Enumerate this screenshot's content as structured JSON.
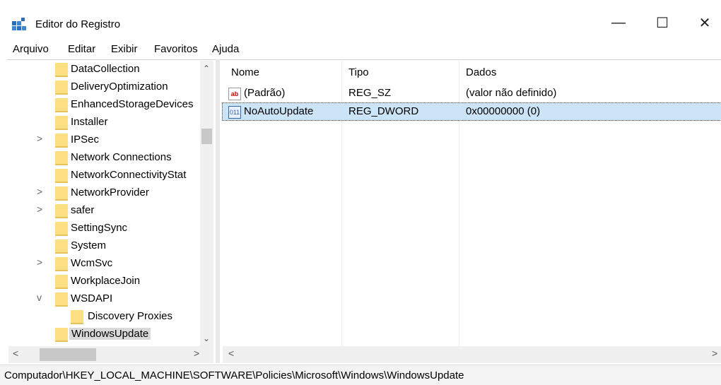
{
  "window": {
    "title": "Editor do Registro",
    "min": "—",
    "max": "☐",
    "close": "✕"
  },
  "menu": [
    "Arquivo",
    "Editar",
    "Exibir",
    "Favoritos",
    "Ajuda"
  ],
  "tree": {
    "items": [
      {
        "label": "DataCollection",
        "expander": ""
      },
      {
        "label": "DeliveryOptimization",
        "expander": ""
      },
      {
        "label": "EnhancedStorageDevices",
        "expander": ""
      },
      {
        "label": "Installer",
        "expander": ""
      },
      {
        "label": "IPSec",
        "expander": ">"
      },
      {
        "label": "Network Connections",
        "expander": ""
      },
      {
        "label": "NetworkConnectivityStat",
        "expander": ""
      },
      {
        "label": "NetworkProvider",
        "expander": ">"
      },
      {
        "label": "safer",
        "expander": ">"
      },
      {
        "label": "SettingSync",
        "expander": ""
      },
      {
        "label": "System",
        "expander": ""
      },
      {
        "label": "WcmSvc",
        "expander": ">"
      },
      {
        "label": "WorkplaceJoin",
        "expander": ""
      },
      {
        "label": "WSDAPI",
        "expander": "v"
      },
      {
        "label": "Discovery Proxies",
        "expander": ""
      },
      {
        "label": "WindowsUpdate",
        "expander": ""
      }
    ]
  },
  "list": {
    "columns": [
      "Nome",
      "Tipo",
      "Dados"
    ],
    "rows": [
      {
        "icon": "string-value-icon",
        "name": "(Padrão)",
        "type": "REG_SZ",
        "data": "(valor não definido)"
      },
      {
        "icon": "dword-value-icon",
        "name": "NoAutoUpdate",
        "type": "REG_DWORD",
        "data": "0x00000000 (0)"
      }
    ]
  },
  "status": {
    "path": "Computador\\HKEY_LOCAL_MACHINE\\SOFTWARE\\Policies\\Microsoft\\Windows\\WindowsUpdate"
  }
}
